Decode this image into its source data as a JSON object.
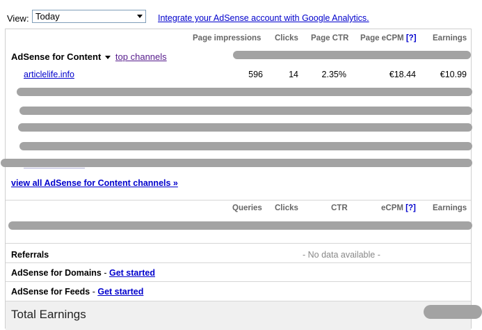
{
  "view": {
    "label": "View:",
    "selected": "Today",
    "ga_link": "Integrate your AdSense account with Google Analytics."
  },
  "content_table": {
    "headers": {
      "impressions": "Page impressions",
      "clicks": "Clicks",
      "ctr": "Page CTR",
      "ecpm": "Page eCPM",
      "help": "[?]",
      "earnings": "Earnings"
    },
    "section_title": "AdSense for Content",
    "top_channels_link": "top channels",
    "rows": [
      {
        "channel": "articlelife.info",
        "impressions": "596",
        "clicks": "14",
        "ctr": "2.35%",
        "ecpm": "€18.44",
        "earnings": "€10.99"
      }
    ],
    "view_all_link": "view all AdSense for Content channels »"
  },
  "search_table": {
    "headers": {
      "queries": "Queries",
      "clicks": "Clicks",
      "ctr": "CTR",
      "ecpm": "eCPM",
      "help": "[?]",
      "earnings": "Earnings"
    }
  },
  "referrals": {
    "label": "Referrals",
    "status": "- No data available -"
  },
  "domains": {
    "label": "AdSense for Domains",
    "sep": " - ",
    "link": "Get started"
  },
  "feeds": {
    "label": "AdSense for Feeds",
    "sep": " - ",
    "link": "Get started"
  },
  "total": {
    "label": "Total Earnings"
  }
}
